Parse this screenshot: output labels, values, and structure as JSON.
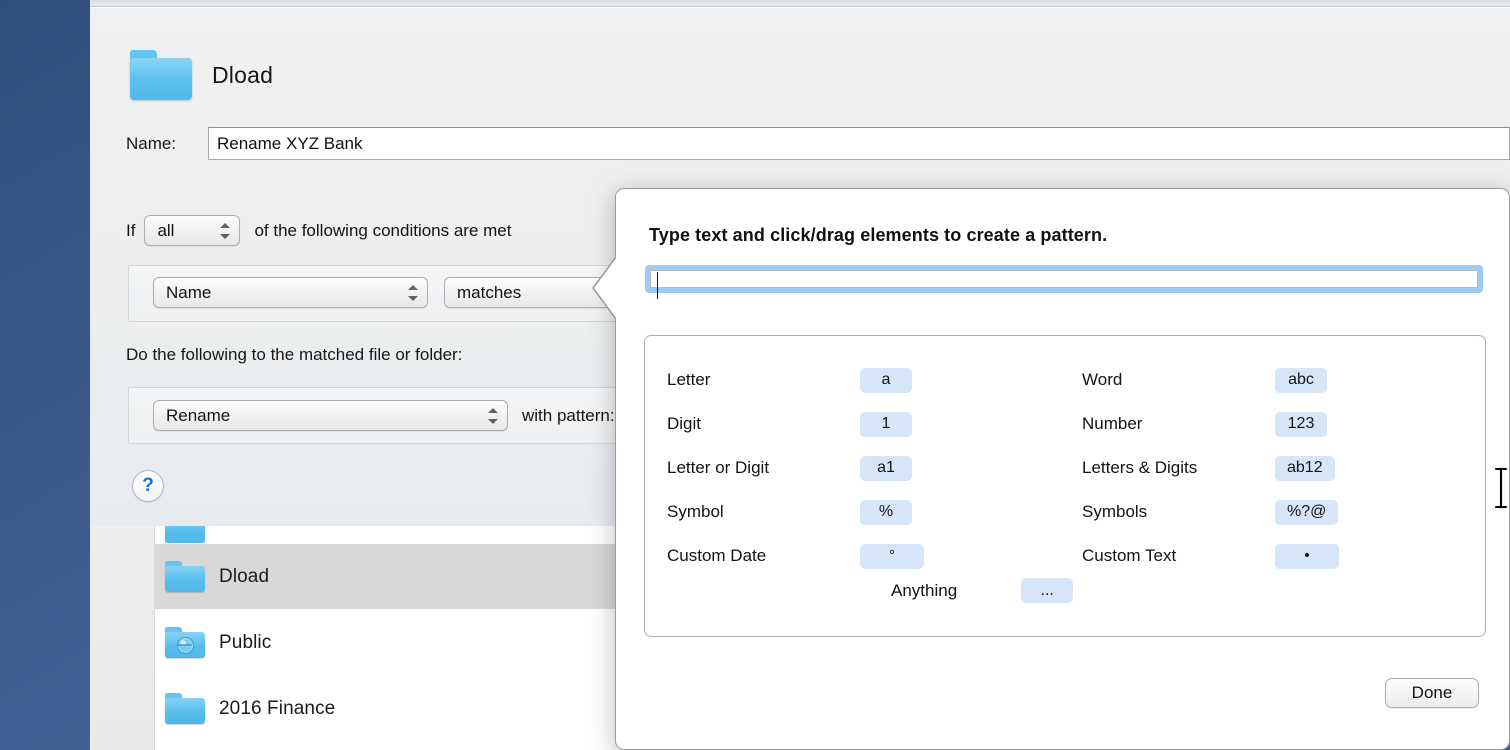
{
  "window": {
    "folder_icon": "folder-icon",
    "title": "Dload"
  },
  "name_row": {
    "label": "Name:",
    "value": "Rename XYZ Bank",
    "placeholder": "",
    "note_icon": "document-note-icon"
  },
  "conditions": {
    "if_word": "If",
    "scope_value": "all",
    "trailing_text": "of the following conditions are met",
    "row": {
      "attribute": "Name",
      "operator": "matches"
    }
  },
  "actions": {
    "heading": "Do the following to the matched file or folder:",
    "kind": "Rename",
    "with_pattern_label": "with pattern:",
    "pattern_value": ""
  },
  "help": {
    "glyph": "?",
    "icon": "question-mark-icon"
  },
  "popover": {
    "title": "Type text and click/drag elements to create a pattern.",
    "input_value": "",
    "input_placeholder": "",
    "done_label": "Done",
    "tokens": [
      {
        "label": "Letter",
        "chip": "a",
        "icon": "letter-token-chip"
      },
      {
        "label": "Word",
        "chip": "abc",
        "icon": "word-token-chip"
      },
      {
        "label": "Digit",
        "chip": "1",
        "icon": "digit-token-chip"
      },
      {
        "label": "Number",
        "chip": "123",
        "icon": "number-token-chip"
      },
      {
        "label": "Letter or Digit",
        "chip": "a1",
        "icon": "letter-or-digit-token-chip"
      },
      {
        "label": "Letters & Digits",
        "chip": "ab12",
        "icon": "letters-and-digits-token-chip"
      },
      {
        "label": "Symbol",
        "chip": "%",
        "icon": "symbol-token-chip"
      },
      {
        "label": "Symbols",
        "chip": "%?@",
        "icon": "symbols-token-chip"
      },
      {
        "label": "Custom Date",
        "chip": "°",
        "icon": "custom-date-token-chip"
      },
      {
        "label": "Custom Text",
        "chip": "•",
        "icon": "custom-text-token-chip"
      }
    ],
    "anything": {
      "label": "Anything",
      "chip": "..."
    }
  },
  "finder": {
    "rows": [
      {
        "name": "",
        "icon": "folder-icon",
        "selected": false,
        "partial": true
      },
      {
        "name": "Dload",
        "icon": "folder-icon",
        "selected": true,
        "partial": false
      },
      {
        "name": "Public",
        "icon": "folder-globe-icon",
        "selected": false,
        "partial": false
      },
      {
        "name": "2016 Finance",
        "icon": "folder-icon",
        "selected": false,
        "partial": false
      }
    ]
  },
  "colors": {
    "accent_blue": "#1673d8",
    "focus_ring": "#9ecbf0",
    "chip_blue": "#d7e5f9",
    "folder_blue": "#5cc0ed",
    "wallpaper": "#3f6092",
    "selection_gray": "#d8d8d8"
  }
}
